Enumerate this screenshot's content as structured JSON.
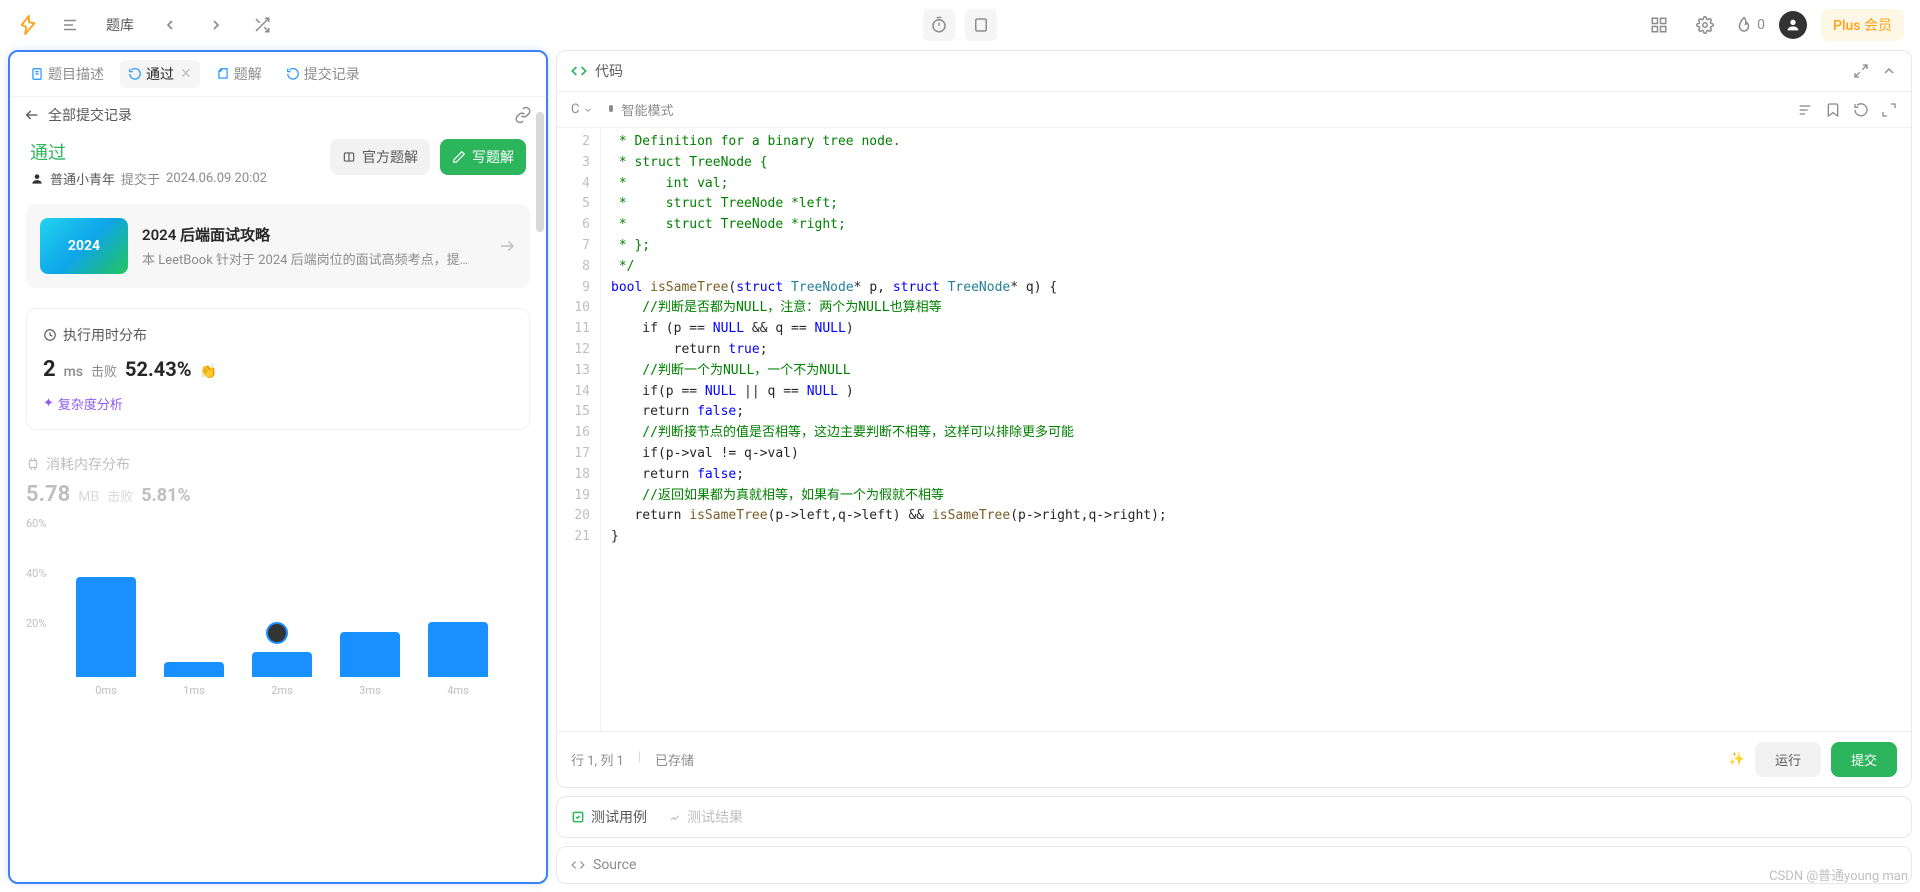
{
  "topbar": {
    "problems_label": "题库",
    "streak_count": "0",
    "plus_label": "Plus 会员"
  },
  "tabs": {
    "description": "题目描述",
    "accepted": "通过",
    "solution": "题解",
    "submissions": "提交记录"
  },
  "subheader": {
    "back_label": "全部提交记录"
  },
  "status": {
    "text": "通过",
    "user": "普通小青年",
    "submit_prefix": "提交于",
    "submit_time": "2024.06.09 20:02",
    "official_solution": "官方题解",
    "write_solution": "写题解"
  },
  "promo": {
    "badge": "2024",
    "title": "2024 后端面试攻略",
    "desc": "本 LeetBook 针对于 2024 后端岗位的面试高频考点，提…"
  },
  "runtime": {
    "title": "执行用时分布",
    "value": "2",
    "unit": "ms",
    "beat_label": "击败",
    "beat_pct": "52.43%",
    "complexity": "复杂度分析"
  },
  "memory": {
    "title": "消耗内存分布",
    "value": "5.78",
    "unit": "MB",
    "beat_label": "击败",
    "beat_pct": "5.81%"
  },
  "chart_data": {
    "type": "bar",
    "categories": [
      "0ms",
      "1ms",
      "2ms",
      "3ms",
      "4ms"
    ],
    "values": [
      40,
      6,
      10,
      18,
      22
    ],
    "ylabel": "%",
    "ylim": [
      0,
      60
    ],
    "yticks": [
      "20%",
      "40%",
      "60%"
    ],
    "marker_index": 2
  },
  "code_header": {
    "title": "代码"
  },
  "code_toolbar": {
    "lang": "C",
    "mode": "智能模式"
  },
  "code_lines": {
    "start": 2,
    "end": 21,
    "l2": " * Definition for a binary tree node.",
    "l3": " * struct TreeNode {",
    "l4": " *     int val;",
    "l5": " *     struct TreeNode *left;",
    "l6": " *     struct TreeNode *right;",
    "l7": " * };",
    "l8": " */",
    "l9_bool": "bool",
    "l9_fn": "isSameTree",
    "l9_struct": "struct",
    "l9_type": "TreeNode",
    "l9_rest1": "* p, ",
    "l9_rest2": "* q) {",
    "l10": "    //判断是否都为NULL，注意：两个为NULL也算相等",
    "l11_a": "    if (p == ",
    "l11_b": " && q == ",
    "l11_null": "NULL",
    "l11_c": ")",
    "l12_a": "        return ",
    "l12_b": "true",
    "l12_c": ";",
    "l13": "    //判断一个为NULL，一个不为NULL",
    "l14_a": "    if(p == ",
    "l14_b": " || q == ",
    "l14_c": " )",
    "l15_a": "    return ",
    "l15_b": "false",
    "l15_c": ";",
    "l16": "    //判断接节点的值是否相等，这边主要判断不相等，这样可以排除更多可能",
    "l17": "    if(p->val != q->val)",
    "l18_a": "    return ",
    "l18_b": "false",
    "l18_c": ";",
    "l19": "    //返回如果都为真就相等，如果有一个为假就不相等",
    "l20_a": "   return ",
    "l20_fn": "isSameTree",
    "l20_b": "(p->left,q->left) && ",
    "l20_c": "(p->right,q->right);",
    "l21": "}"
  },
  "code_status": {
    "position": "行 1, 列 1",
    "saved": "已存储",
    "run": "运行",
    "submit": "提交"
  },
  "test": {
    "cases": "测试用例",
    "results": "测试结果"
  },
  "source": {
    "label": "Source"
  },
  "watermark": "CSDN @普通young man"
}
